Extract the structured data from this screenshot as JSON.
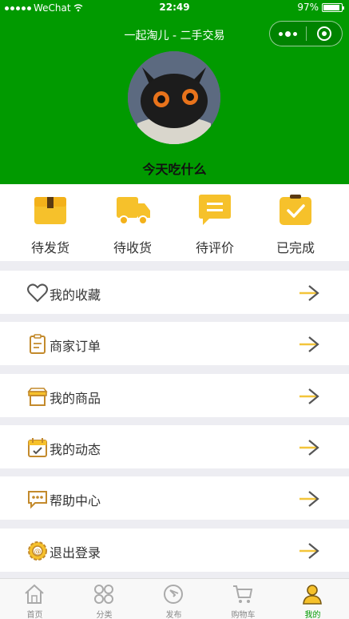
{
  "status_bar": {
    "carrier": "WeChat",
    "time": "22:49",
    "battery": "97%"
  },
  "nav": {
    "title": "一起淘儿 - 二手交易"
  },
  "profile": {
    "nickname": "今天吃什么"
  },
  "orders": [
    {
      "label": "待发货",
      "icon": "package-icon"
    },
    {
      "label": "待收货",
      "icon": "truck-icon"
    },
    {
      "label": "待评价",
      "icon": "comment-icon"
    },
    {
      "label": "已完成",
      "icon": "clipboard-check-icon"
    }
  ],
  "menu": [
    {
      "label": "我的收藏",
      "icon": "heart-icon"
    },
    {
      "label": "商家订单",
      "icon": "clipboard-icon"
    },
    {
      "label": "我的商品",
      "icon": "shop-icon"
    },
    {
      "label": "我的动态",
      "icon": "calendar-icon"
    },
    {
      "label": "帮助中心",
      "icon": "chat-icon"
    },
    {
      "label": "退出登录",
      "icon": "logout-icon"
    }
  ],
  "tabs": [
    {
      "label": "首页",
      "icon": "home-icon",
      "active": false
    },
    {
      "label": "分类",
      "icon": "category-icon",
      "active": false
    },
    {
      "label": "发布",
      "icon": "publish-icon",
      "active": false
    },
    {
      "label": "购物车",
      "icon": "cart-icon",
      "active": false
    },
    {
      "label": "我的",
      "icon": "user-icon",
      "active": true
    }
  ],
  "colors": {
    "brand_green": "#019a00",
    "accent_yellow": "#f6c12b",
    "icon_brown": "#c38a2c"
  }
}
